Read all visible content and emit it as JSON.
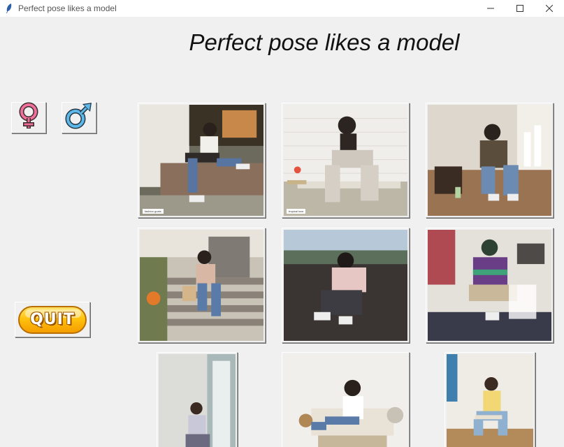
{
  "window": {
    "title": "Perfect pose likes a model",
    "icon": "feather-icon",
    "controls": [
      "minimize-icon",
      "maximize-icon",
      "close-icon"
    ]
  },
  "header": {
    "title": "Perfect pose likes a model"
  },
  "gender_buttons": [
    {
      "icon": "female-symbol-icon",
      "color": "#d9507a"
    },
    {
      "icon": "male-symbol-icon",
      "color": "#3a9ed6"
    }
  ],
  "quit": {
    "label": "QUIT",
    "color": "#ffc20e"
  },
  "photos": [
    {
      "description": "woman sitting on brick ledge",
      "caption": "fashion goals"
    },
    {
      "description": "woman sitting on bench by white brick wall",
      "caption": "tropical love"
    },
    {
      "description": "woman crouching in cafe",
      "caption": ""
    },
    {
      "description": "woman sitting on porch steps",
      "caption": ""
    },
    {
      "description": "woman crouching on rocks by sea",
      "caption": ""
    },
    {
      "description": "woman sitting on chair in striped sweater",
      "caption": ""
    },
    {
      "description": "woman sitting on floor by window",
      "caption": ""
    },
    {
      "description": "woman sitting on sofa",
      "caption": ""
    },
    {
      "description": "woman sitting on chair in yellow shirt",
      "caption": ""
    }
  ]
}
